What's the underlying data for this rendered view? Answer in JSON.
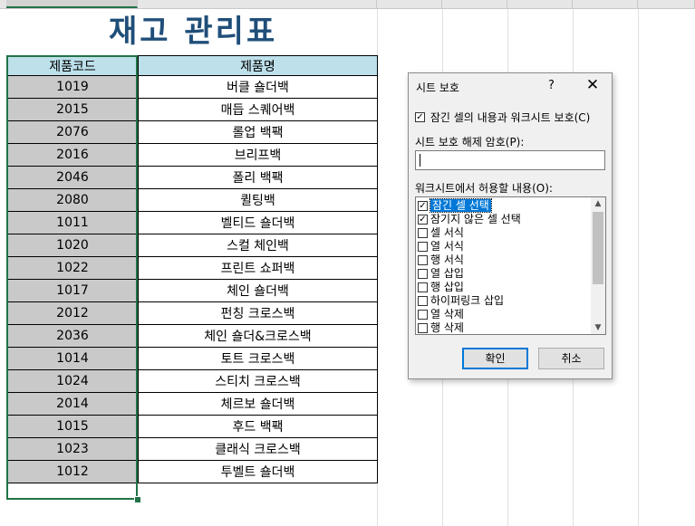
{
  "sheet": {
    "title": "재고 관리표",
    "headers": [
      "제품코드",
      "제품명"
    ],
    "rows": [
      {
        "code": "1019",
        "name": "버클 숄더백"
      },
      {
        "code": "2015",
        "name": "매듭 스퀘어백"
      },
      {
        "code": "2076",
        "name": "롤업 백팩"
      },
      {
        "code": "2016",
        "name": "브리프백"
      },
      {
        "code": "2046",
        "name": "폴리 백팩"
      },
      {
        "code": "2080",
        "name": "퀼팅백"
      },
      {
        "code": "1011",
        "name": "벨티드 숄더백"
      },
      {
        "code": "1020",
        "name": "스컬 체인백"
      },
      {
        "code": "1022",
        "name": "프린트 쇼퍼백"
      },
      {
        "code": "1017",
        "name": "체인 숄더백"
      },
      {
        "code": "2012",
        "name": "펀칭 크로스백"
      },
      {
        "code": "2036",
        "name": "체인 숄더&크로스백"
      },
      {
        "code": "1014",
        "name": "토트 크로스백"
      },
      {
        "code": "1024",
        "name": "스티치 크로스백"
      },
      {
        "code": "2014",
        "name": "체르보 숄더백"
      },
      {
        "code": "1015",
        "name": "후드 백팩"
      },
      {
        "code": "1023",
        "name": "클래식 크로스백"
      },
      {
        "code": "1012",
        "name": "투벨트 숄더백"
      }
    ]
  },
  "dialog": {
    "title": "시트 보호",
    "help": "?",
    "close": "✕",
    "protect_label": "잠긴 셀의 내용과 워크시트 보호(C)",
    "protect_checked": true,
    "password_label": "시트 보호 해제 암호(P):",
    "password_value": "",
    "allow_label": "워크시트에서 허용할 내용(O):",
    "options": [
      {
        "label": "잠긴 셀 선택",
        "checked": true,
        "highlighted": true
      },
      {
        "label": "잠기지 않은 셀 선택",
        "checked": true,
        "highlighted": false
      },
      {
        "label": "셀 서식",
        "checked": false,
        "highlighted": false
      },
      {
        "label": "열 서식",
        "checked": false,
        "highlighted": false
      },
      {
        "label": "행 서식",
        "checked": false,
        "highlighted": false
      },
      {
        "label": "열 삽입",
        "checked": false,
        "highlighted": false
      },
      {
        "label": "행 삽입",
        "checked": false,
        "highlighted": false
      },
      {
        "label": "하이퍼링크 삽입",
        "checked": false,
        "highlighted": false
      },
      {
        "label": "열 삭제",
        "checked": false,
        "highlighted": false
      },
      {
        "label": "행 삭제",
        "checked": false,
        "highlighted": false
      }
    ],
    "ok_label": "확인",
    "cancel_label": "취소"
  }
}
